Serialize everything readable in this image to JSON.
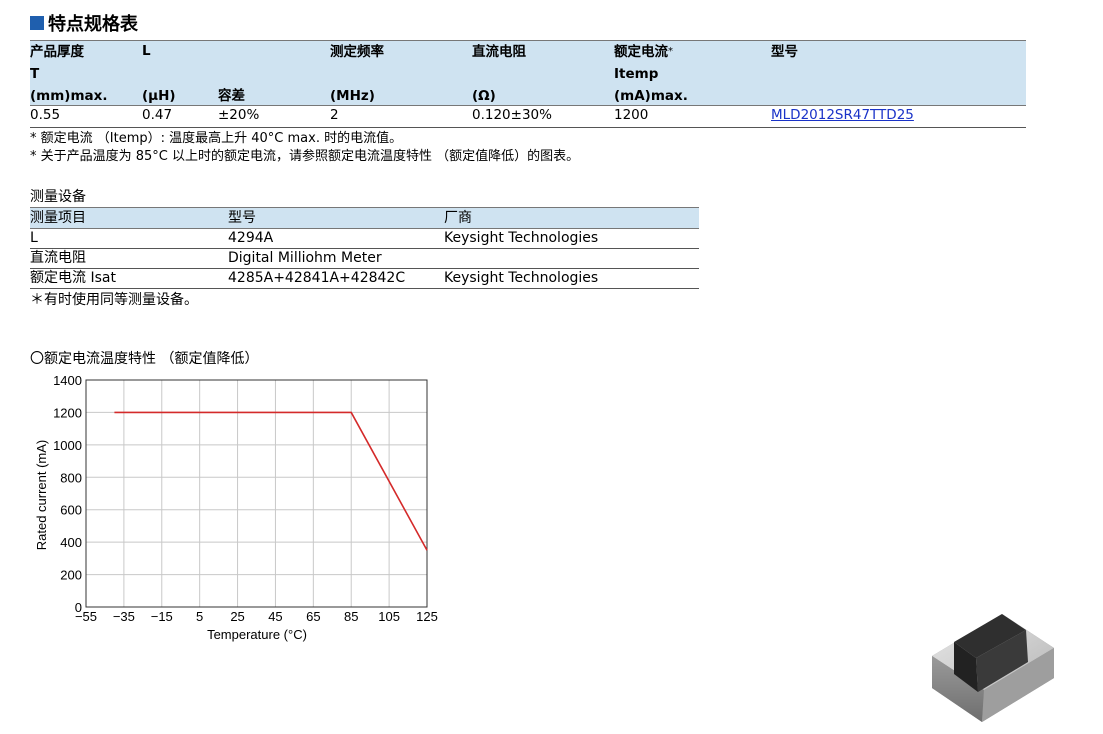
{
  "section_title": "特点规格表",
  "spec_table": {
    "headers": {
      "thickness_1": "产品厚度",
      "thickness_2": "T",
      "thickness_3": "(mm)max.",
      "l_1": "L",
      "l_unit": "(μH)",
      "tolerance": "容差",
      "freq_1": "测定频率",
      "freq_unit": "(MHz)",
      "dcr_1": "直流电阻",
      "dcr_unit": "(Ω)",
      "rated_1": "额定电流",
      "rated_star": "*",
      "rated_2": "Itemp",
      "rated_3": "(mA)max.",
      "model": "型号"
    },
    "row": {
      "thickness": "0.55",
      "l": "0.47",
      "tolerance": "±20%",
      "freq": "2",
      "dcr": "0.120±30%",
      "rated": "1200",
      "model": "MLD2012SR47TTD25"
    },
    "notes": [
      "* 额定电流 （Itemp）: 温度最高上升 40°C max. 时的电流值。",
      "* 关于产品温度为 85°C 以上时的额定电流，请参照额定电流温度特性 （额定值降低）的图表。"
    ]
  },
  "equipment": {
    "title": "测量设备",
    "headers": [
      "测量项目",
      "型号",
      "厂商"
    ],
    "rows": [
      [
        "L",
        "4294A",
        "Keysight Technologies"
      ],
      [
        "直流电阻",
        "Digital Milliohm Meter",
        ""
      ],
      [
        "额定电流 Isat",
        "4285A+42841A+42842C",
        "Keysight Technologies"
      ]
    ],
    "note": "＊有时使用同等测量设备。"
  },
  "chart_title": "〇额定电流温度特性 （额定值降低）",
  "chart_data": {
    "type": "line",
    "title": "",
    "xlabel": "Temperature (°C)",
    "ylabel": "Rated current (mA)",
    "xlim": [
      -55,
      125
    ],
    "ylim": [
      0,
      1400
    ],
    "xticks": [
      -55,
      -35,
      -15,
      5,
      25,
      45,
      65,
      85,
      105,
      125
    ],
    "yticks": [
      0,
      200,
      400,
      600,
      800,
      1000,
      1200,
      1400
    ],
    "xtick_labels": [
      "−55",
      "−35",
      "−15",
      "5",
      "25",
      "45",
      "65",
      "85",
      "105",
      "125"
    ],
    "grid": true,
    "series": [
      {
        "x": [
          -40,
          85,
          125
        ],
        "y": [
          1200,
          1200,
          350
        ],
        "color": "#d42a2a"
      }
    ]
  },
  "colors": {
    "accent": "#1f5fae",
    "header_bg": "#cfe3f1",
    "line": "#d42a2a",
    "link": "#1a33c8"
  }
}
